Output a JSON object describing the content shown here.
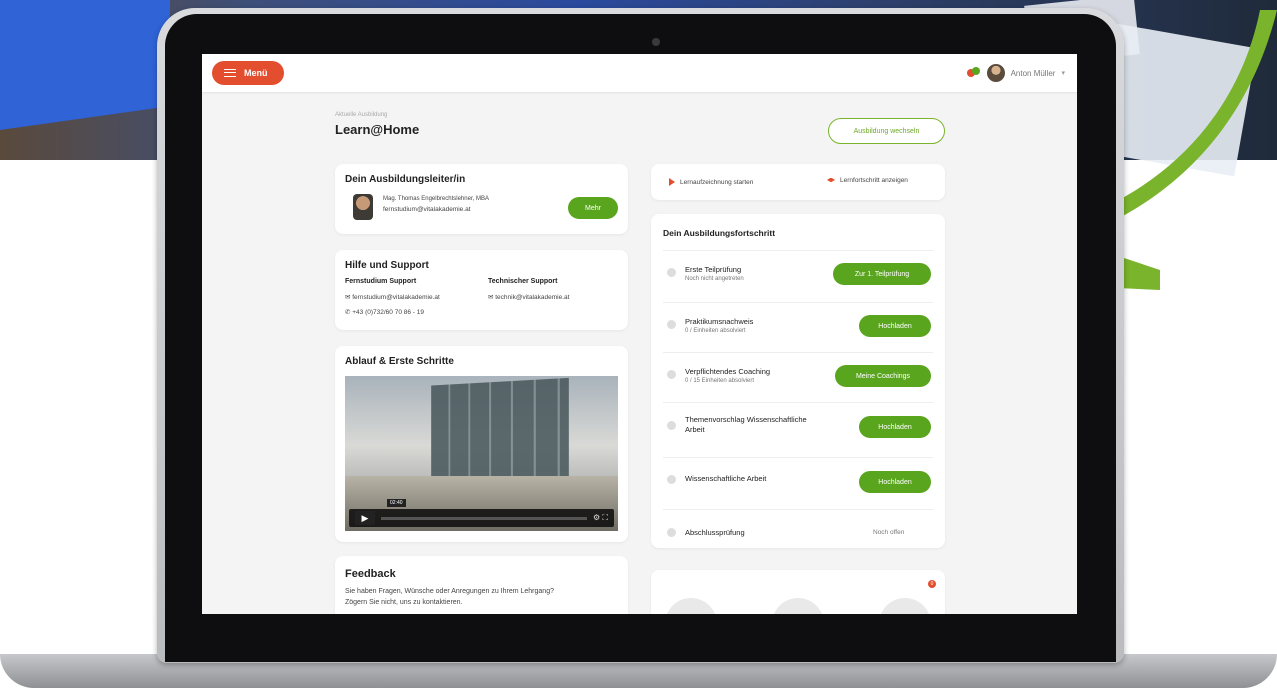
{
  "topbar": {
    "menu_label": "Menü",
    "user_name": "Anton Müller",
    "caret": "▾"
  },
  "page": {
    "eyebrow": "Aktuelle Ausbildung",
    "title": "Learn@Home",
    "switch_label": "Ausbildung wechseln"
  },
  "leader": {
    "heading": "Dein Ausbildungsleiter/in",
    "name": "Mag. Thomas Engelbrechtslehner, MBA",
    "email": "fernstudium@vitalakademie.at",
    "more_label": "Mehr"
  },
  "support": {
    "heading": "Hilfe und Support",
    "fern_title": "Fernstudium Support",
    "fern_email": "✉ fernstudium@vitalakademie.at",
    "phone": "✆ +43 (0)732/60 70 86 - 19",
    "tech_title": "Technischer Support",
    "tech_email": "✉ technik@vitalakademie.at"
  },
  "video": {
    "heading": "Ablauf & Erste Schritte",
    "time": "02:40",
    "play": "▶",
    "controls": "⚙ ⛶"
  },
  "feedback": {
    "heading": "Feedback",
    "line1": "Sie haben Fragen, Wünsche oder Anregungen zu Ihrem Lehrgang?",
    "line2": "Zögern Sie nicht, uns zu kontaktieren."
  },
  "actions": {
    "record_label": "Lernaufzeichnung starten",
    "progress_label": "Lernfortschritt anzeigen"
  },
  "progress": {
    "heading": "Dein Ausbildungsfortschritt",
    "items": [
      {
        "title": "Erste Teilprüfung",
        "sub": "Noch nicht angetreten",
        "action": "Zur 1. Teilprüfung"
      },
      {
        "title": "Praktikumsnachweis",
        "sub": "0 / Einheiten absolviert",
        "action": "Hochladen"
      },
      {
        "title": "Verpflichtendes Coaching",
        "sub": "0 / 15 Einheiten absolviert",
        "action": "Meine Coachings"
      },
      {
        "title": "Themenvorschlag Wissenschaftliche",
        "title2": "Arbeit",
        "sub": "",
        "action": "Hochladen"
      },
      {
        "title": "Wissenschaftliche Arbeit",
        "sub": "",
        "action": "Hochladen"
      },
      {
        "title": "Abschlussprüfung",
        "sub": "",
        "action": "Noch offen"
      }
    ]
  },
  "badge_count": "0",
  "colors": {
    "accent_green": "#5aa51e",
    "menu_red": "#e24e2e",
    "arrow_green": "#7ab42c"
  }
}
